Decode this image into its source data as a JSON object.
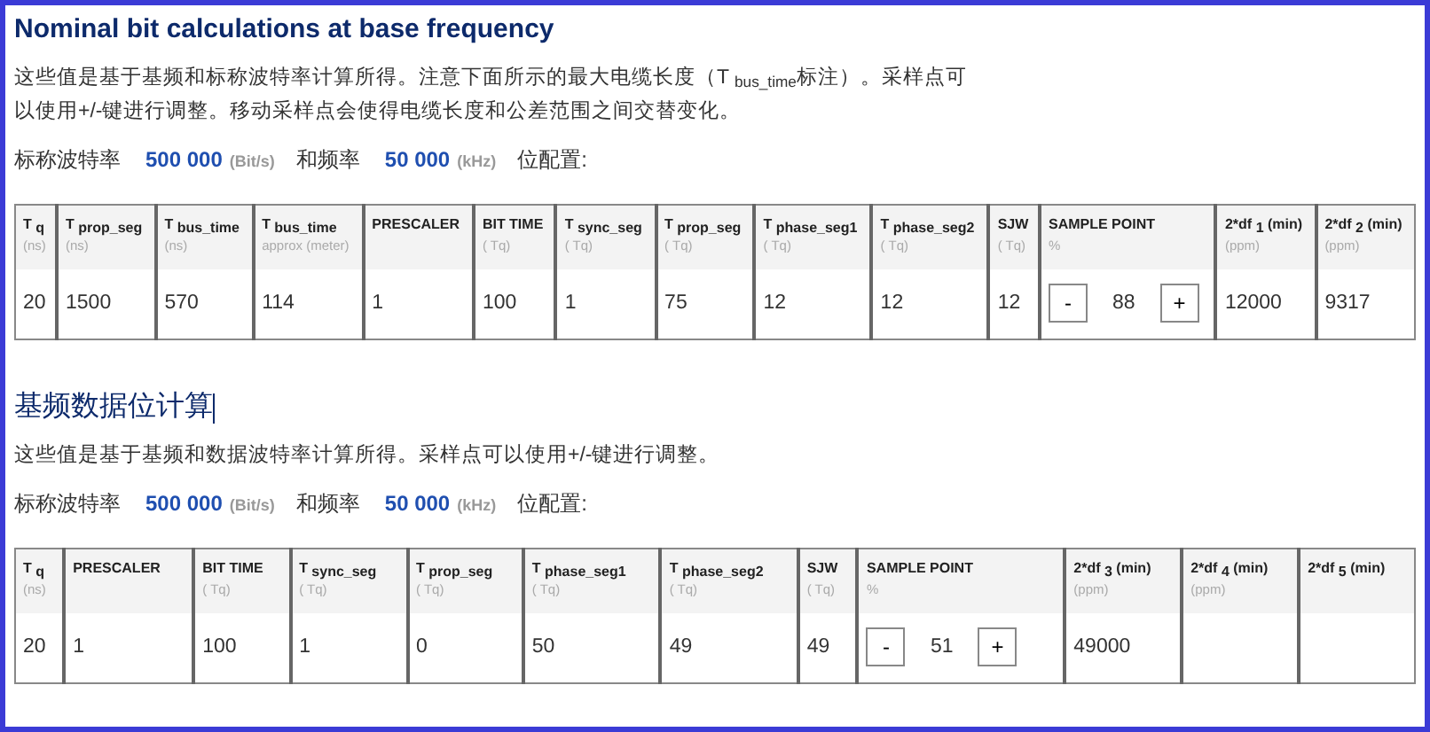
{
  "sections": [
    {
      "title": "Nominal bit calculations at base frequency",
      "bold": true,
      "cursor": false,
      "description": "这些值是基于基频和标称波特率计算所得。注意下面所示的最大电缆长度（T $_{bus_time}$标注）。采样点可以使用+/-键进行调整。移动采样点会使得电缆长度和公差范围之间交替变化。",
      "config": {
        "label_1": "标称波特率",
        "bitrate": "500 000",
        "bitrate_unit": "(Bit/s)",
        "label_2": "和频率",
        "frequency": "50 000",
        "frequency_unit": "(kHz)",
        "label_3": "位配置:"
      },
      "columns": [
        {
          "title": "T $_{q}$",
          "unit": "(ns)"
        },
        {
          "title": "T $_{prop_seg}$",
          "unit": "(ns)"
        },
        {
          "title": "T $_{bus_time}$",
          "unit": "(ns)"
        },
        {
          "title": "T $_{bus_time}$",
          "unit": "approx (meter)"
        },
        {
          "title": "PRESCALER"
        },
        {
          "title": "BIT TIME",
          "unit": "( Tq)"
        },
        {
          "title": "T $_{sync_seg}$",
          "unit": "( Tq)"
        },
        {
          "title": "T $_{prop_seg}$",
          "unit": "( Tq)"
        },
        {
          "title": "T $_{phase_seg1}$",
          "unit": "( Tq)"
        },
        {
          "title": "T $_{phase_seg2}$",
          "unit": "( Tq)"
        },
        {
          "title": "SJW",
          "unit": "( Tq)"
        },
        {
          "title": "SAMPLE POINT",
          "unit": "%"
        },
        {
          "title": "2*df $_{1}$ (min)",
          "unit": "(ppm)"
        },
        {
          "title": "2*df $_{2}$ (min)",
          "unit": "(ppm)"
        }
      ],
      "row": [
        {
          "kind": "text",
          "value": "20"
        },
        {
          "kind": "text",
          "value": "1500"
        },
        {
          "kind": "text",
          "value": "570"
        },
        {
          "kind": "text",
          "value": "114"
        },
        {
          "kind": "text",
          "value": "1"
        },
        {
          "kind": "text",
          "value": "100"
        },
        {
          "kind": "text",
          "value": "1"
        },
        {
          "kind": "text",
          "value": "75"
        },
        {
          "kind": "text",
          "value": "12"
        },
        {
          "kind": "text",
          "value": "12"
        },
        {
          "kind": "text",
          "value": "12"
        },
        {
          "kind": "stepper",
          "minus": "-",
          "value": "88",
          "plus": "+"
        },
        {
          "kind": "text",
          "value": "12000"
        },
        {
          "kind": "text",
          "value": "9317"
        }
      ]
    },
    {
      "title": "基频数据位计算",
      "bold": false,
      "cursor": true,
      "description": "这些值是基于基频和数据波特率计算所得。采样点可以使用+/-键进行调整。",
      "config": {
        "label_1": "标称波特率",
        "bitrate": "500 000",
        "bitrate_unit": "(Bit/s)",
        "label_2": "和频率",
        "frequency": "50 000",
        "frequency_unit": "(kHz)",
        "label_3": "位配置:"
      },
      "columns": [
        {
          "title": "T $_{q}$",
          "unit": "(ns)"
        },
        {
          "title": "PRESCALER"
        },
        {
          "title": "BIT TIME",
          "unit": "( Tq)"
        },
        {
          "title": "T $_{sync_seg}$",
          "unit": "( Tq)"
        },
        {
          "title": "T $_{prop_seg}$",
          "unit": "( Tq)"
        },
        {
          "title": "T $_{phase_seg1}$",
          "unit": "( Tq)"
        },
        {
          "title": "T $_{phase_seg2}$",
          "unit": "( Tq)"
        },
        {
          "title": "SJW",
          "unit": "( Tq)"
        },
        {
          "title": "SAMPLE POINT",
          "unit": "%"
        },
        {
          "title": "2*df $_{3}$ (min)",
          "unit": "(ppm)"
        },
        {
          "title": "2*df $_{4}$ (min)",
          "unit": "(ppm)"
        },
        {
          "title": "2*df $_{5}$ (min)"
        }
      ],
      "row": [
        {
          "kind": "text",
          "value": "20"
        },
        {
          "kind": "text",
          "value": "1"
        },
        {
          "kind": "text",
          "value": "100"
        },
        {
          "kind": "text",
          "value": "1"
        },
        {
          "kind": "text",
          "value": "0"
        },
        {
          "kind": "text",
          "value": "50"
        },
        {
          "kind": "text",
          "value": "49"
        },
        {
          "kind": "text",
          "value": "49"
        },
        {
          "kind": "stepper",
          "minus": "-",
          "value": "51",
          "plus": "+"
        },
        {
          "kind": "text",
          "value": "49000"
        },
        {
          "kind": "text"
        },
        {
          "kind": "text"
        }
      ]
    }
  ]
}
